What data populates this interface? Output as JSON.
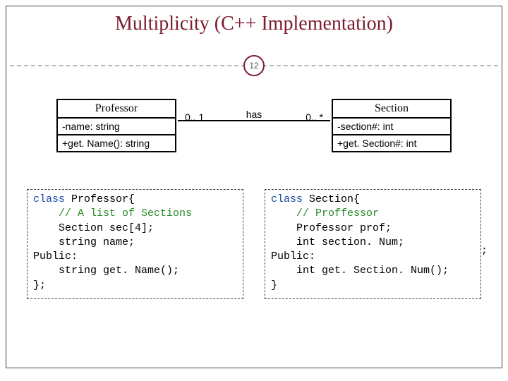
{
  "title": "Multiplicity (C++  Implementation)",
  "page_number": "12",
  "uml": {
    "left": {
      "name": "Professor",
      "attr": "-name: string",
      "op": "+get. Name(): string"
    },
    "right": {
      "name": "Section",
      "attr": "-section#: int",
      "op": "+get. Section#: int"
    },
    "assoc": {
      "left_mult": "0.. 1",
      "label": "has",
      "right_mult": "0.. *"
    }
  },
  "code": {
    "left": {
      "l1a": "class",
      "l1b": " Professor{",
      "l2a": "    ",
      "l2b": "// A list of Sections",
      "l3": "    Section sec[4];",
      "l4": "    string name;",
      "l5": "Public:",
      "l6": "    string get. Name();",
      "l7": "};"
    },
    "right": {
      "l1a": "class",
      "l1b": " Section{",
      "l2a": "    ",
      "l2b": "// Proffessor",
      "l3": "    Professor prof;",
      "l4": "    int section. Num;",
      "l5": "Public:",
      "l6": "    int get. Section. Num();",
      "l7": "}",
      "trailing": ";"
    }
  }
}
